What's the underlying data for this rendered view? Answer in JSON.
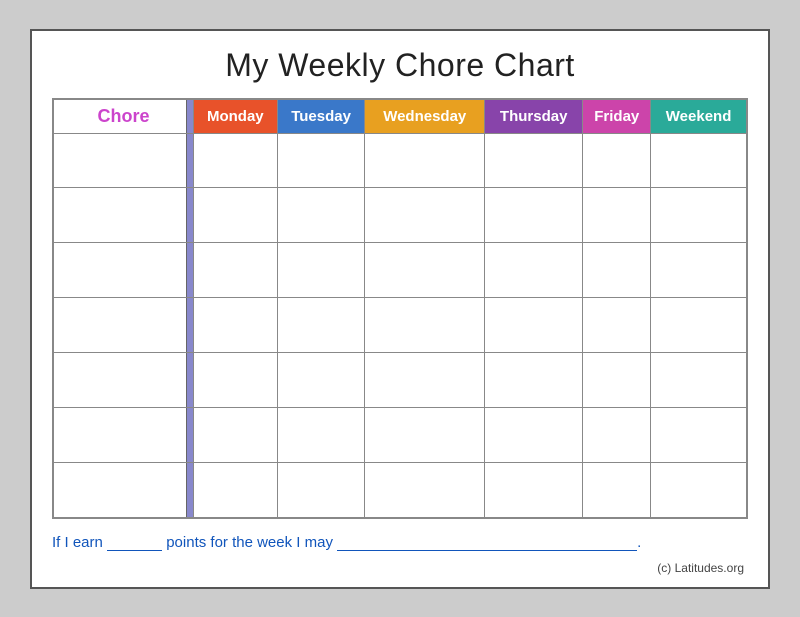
{
  "title": "My Weekly Chore Chart",
  "chore_label": "Chore",
  "days": [
    {
      "label": "Monday",
      "class": "mon"
    },
    {
      "label": "Tuesday",
      "class": "tue"
    },
    {
      "label": "Wednesday",
      "class": "wed"
    },
    {
      "label": "Thursday",
      "class": "thu"
    },
    {
      "label": "Friday",
      "class": "fri"
    },
    {
      "label": "Weekend",
      "class": "sat"
    }
  ],
  "rows": 7,
  "footer": {
    "prefix": "If I earn",
    "blank1": "",
    "middle": "points for the week I may",
    "blank2": "",
    "suffix": "."
  },
  "copyright": "(c) Latitudes.org"
}
